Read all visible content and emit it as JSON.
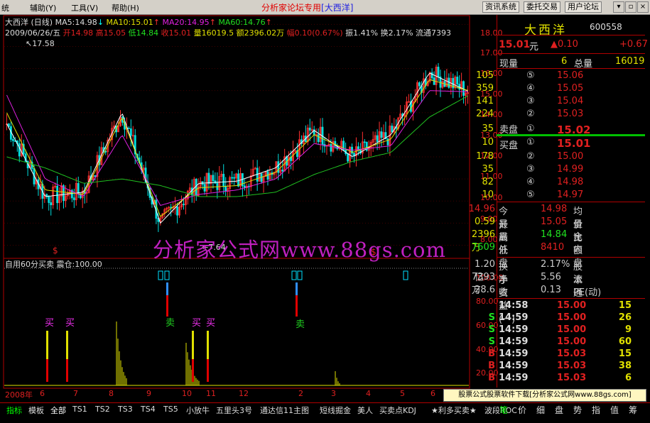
{
  "menubar": {
    "items": [
      "统",
      "辅助(Y)",
      "工具(V)",
      "帮助(H)"
    ],
    "title": "分析家论坛专用",
    "title_stock": "[大西洋]",
    "buttons": [
      "资讯系统",
      "委托交易",
      "用户论坛"
    ]
  },
  "chart": {
    "header": {
      "name": "大西洋 (日线)",
      "ma5": "MA5:14.98",
      "ma10": "MA10:15.01",
      "ma20": "MA20:14.95",
      "ma60": "MA60:14.76"
    },
    "quote_line": {
      "date": "2009/06/26/五",
      "open": "开14.98",
      "high": "高15.05",
      "low": "低14.84",
      "close": "收15.01",
      "volume": "量16019.5",
      "amount": "额2396.02万",
      "change": "幅0.10(0.67%)",
      "amplitude": "振1.41%",
      "turnover": "换2.17%",
      "float": "流通7393"
    },
    "peak_label": "17.58",
    "low_label": "7.64",
    "s_markers": [
      "$",
      "$"
    ],
    "watermark": "分析家公式网www.88gs.com",
    "indicator_label": "自用60分买卖",
    "indicator_param": "震仓:100.00",
    "buy_labels": [
      "买",
      "买",
      "买",
      "买"
    ],
    "sell_labels": [
      "卖",
      "卖"
    ],
    "price_axis": [
      "18.00",
      "17.00",
      "16.00",
      "15.00",
      "14.00",
      "13.00",
      "12.00",
      "11.00",
      "10.00",
      "9.00",
      "8.00"
    ],
    "ind_axis": [
      "100.00",
      "80.00",
      "60.00",
      "40.00",
      "20.00"
    ],
    "date_axis": [
      "2008年",
      "6",
      "7",
      "8",
      "9",
      "10",
      "11",
      "12",
      "2",
      "3",
      "4",
      "5",
      "6"
    ]
  },
  "chart_data": {
    "type": "line",
    "title": "大西洋 (日线)",
    "x": [
      "2008-06",
      "2008-07",
      "2008-08",
      "2008-09",
      "2008-10",
      "2008-11",
      "2008-12",
      "2009-01",
      "2009-02",
      "2009-03",
      "2009-04",
      "2009-05",
      "2009-06"
    ],
    "series": [
      {
        "name": "MA5",
        "values": [
          13.5,
          10.2,
          10.4,
          14.0,
          9.0,
          10.8,
          10.9,
          11.5,
          13.2,
          12.0,
          13.0,
          15.8,
          14.98
        ]
      },
      {
        "name": "MA10",
        "values": [
          14.0,
          10.5,
          10.3,
          13.8,
          9.3,
          10.6,
          10.7,
          11.3,
          13.0,
          12.2,
          12.8,
          15.5,
          15.01
        ]
      },
      {
        "name": "MA20",
        "values": [
          14.8,
          11.0,
          10.2,
          13.0,
          9.8,
          10.3,
          10.5,
          11.0,
          12.6,
          12.3,
          12.5,
          15.0,
          14.95
        ]
      },
      {
        "name": "MA60",
        "values": [
          12.0,
          11.5,
          10.8,
          11.0,
          10.7,
          10.2,
          10.2,
          10.4,
          11.2,
          11.8,
          12.2,
          13.8,
          14.76
        ]
      }
    ],
    "ylim": [
      7.5,
      18.3
    ],
    "ylabel": "",
    "xlabel": ""
  },
  "quote_panel": {
    "stock_name": "大西洋",
    "stock_code": "600558",
    "price": "15.01",
    "price_unit": "元",
    "change": "▲0.10",
    "change_pct": "+0.67",
    "vol_label": "现量",
    "vol_value": "6",
    "total_label": "总量",
    "total_value": "16019",
    "sell": [
      {
        "idx": "⑤",
        "price": "15.06",
        "vol": "105"
      },
      {
        "idx": "④",
        "price": "15.05",
        "vol": "359"
      },
      {
        "idx": "③",
        "price": "15.04",
        "vol": "141"
      },
      {
        "idx": "②",
        "price": "15.03",
        "vol": "224"
      },
      {
        "idx": "①",
        "price": "15.02",
        "vol": "35"
      }
    ],
    "sell_label": "卖盘",
    "buy_label": "买盘",
    "buy": [
      {
        "idx": "①",
        "price": "15.01",
        "vol": "10"
      },
      {
        "idx": "②",
        "price": "15.00",
        "vol": "178"
      },
      {
        "idx": "③",
        "price": "14.99",
        "vol": "35"
      },
      {
        "idx": "④",
        "price": "14.98",
        "vol": "82"
      },
      {
        "idx": "⑤",
        "price": "14.97",
        "vol": "10"
      }
    ],
    "stats": [
      {
        "l1": "今开",
        "v1": "14.98",
        "l2": "均价",
        "v2": "14.96"
      },
      {
        "l1": "最高",
        "v1": "15.05",
        "l2": "量比",
        "v2": "0.59"
      },
      {
        "l1": "最低",
        "v1": "14.84",
        "l2": "金额",
        "v2": "2396万"
      },
      {
        "l1": "外盘",
        "v1": "8410",
        "l2": "内盘",
        "v2": "7609"
      }
    ],
    "fundamentals": [
      {
        "l1": "换手",
        "v1": "2.17%",
        "l2": "股本",
        "v2": "1.20亿"
      },
      {
        "l1": "净资",
        "v1": "5.56",
        "l2": "流通",
        "v2": "7393万"
      },
      {
        "l1": "收益(一)",
        "v1": "0.13",
        "l2": "PE(动)",
        "v2": "28.6"
      }
    ],
    "ticks": [
      {
        "time": "14:58",
        "price": "15.00",
        "vol": "15",
        "side": ""
      },
      {
        "time": "14:59",
        "price": "15.00",
        "vol": "26",
        "side": "S"
      },
      {
        "time": "14:59",
        "price": "15.00",
        "vol": "9",
        "side": "S"
      },
      {
        "time": "14:59",
        "price": "15.00",
        "vol": "60",
        "side": "S"
      },
      {
        "time": "14:59",
        "price": "15.03",
        "vol": "15",
        "side": "B"
      },
      {
        "time": "14:59",
        "price": "15.03",
        "vol": "38",
        "side": "B"
      },
      {
        "time": "14:59",
        "price": "15.03",
        "vol": "6",
        "side": "B"
      }
    ]
  },
  "ad": "股票公式股票软件下载[分析家公式网www.88gs.com]",
  "tabs": [
    "指标",
    "模板",
    "全部",
    "TS1",
    "TS2",
    "TS3",
    "TS4",
    "TS5",
    "小放牛",
    "五里头3号",
    "通达信11主图",
    "短线掘金",
    "美人",
    "买卖点KDJ",
    "★利多买卖★",
    "波段ROC"
  ],
  "right_tabs": [
    "笔",
    "价",
    "细",
    "盘",
    "势",
    "指",
    "值",
    "筹"
  ]
}
